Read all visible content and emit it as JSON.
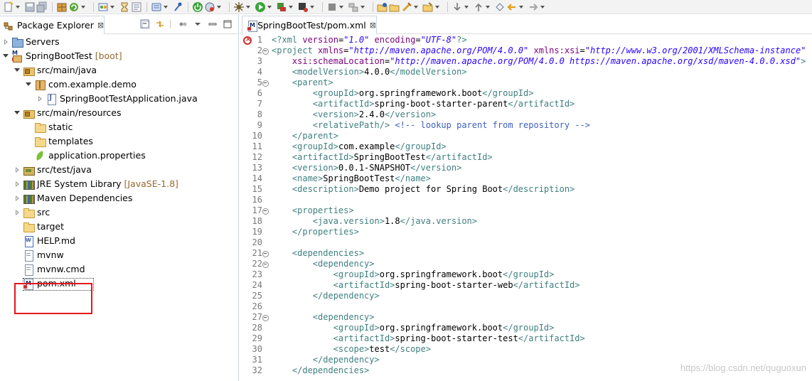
{
  "toolbar": {
    "icons": [
      "new-icon",
      "save-icon",
      "save-all-icon",
      "build-icon",
      "refresh-icon",
      "open-type-icon",
      "task-icon",
      "browse-icon",
      "toggle-breakpoint-icon",
      "skip-breakpoints-icon",
      "spring-icon",
      "debug-icon",
      "run-icon",
      "external-tools-icon",
      "coverage-icon",
      "server-icon",
      "build-project-icon",
      "new-folder-icon",
      "open-folder-icon",
      "search-icon",
      "open-file-icon",
      "annotation-next-icon",
      "annotation-prev-icon",
      "last-edit-icon",
      "back-icon",
      "forward-icon"
    ]
  },
  "explorer": {
    "tab_title": "Package Explorer",
    "close_symbol": "⊠",
    "tree": [
      {
        "label": "Servers",
        "decoration": "",
        "level": 0,
        "expand": "closed",
        "icon": "servers"
      },
      {
        "label": "SpringBootTest",
        "decoration": " [boot]",
        "level": 0,
        "expand": "open",
        "icon": "project"
      },
      {
        "label": "src/main/java",
        "decoration": "",
        "level": 1,
        "expand": "open",
        "icon": "pkgfolder"
      },
      {
        "label": "com.example.demo",
        "decoration": "",
        "level": 2,
        "expand": "open",
        "icon": "package"
      },
      {
        "label": "SpringBootTestApplication.java",
        "decoration": "",
        "level": 3,
        "expand": "closed",
        "icon": "java"
      },
      {
        "label": "src/main/resources",
        "decoration": "",
        "level": 1,
        "expand": "open",
        "icon": "pkgfolder"
      },
      {
        "label": "static",
        "decoration": "",
        "level": 2,
        "expand": "none",
        "icon": "folder"
      },
      {
        "label": "templates",
        "decoration": "",
        "level": 2,
        "expand": "none",
        "icon": "folder"
      },
      {
        "label": "application.properties",
        "decoration": "",
        "level": 2,
        "expand": "none",
        "icon": "leaf"
      },
      {
        "label": "src/test/java",
        "decoration": "",
        "level": 1,
        "expand": "closed",
        "icon": "srcfolder"
      },
      {
        "label": "JRE System Library",
        "decoration": " [JavaSE-1.8]",
        "level": 1,
        "expand": "closed",
        "icon": "lib"
      },
      {
        "label": "Maven Dependencies",
        "decoration": "",
        "level": 1,
        "expand": "closed",
        "icon": "lib"
      },
      {
        "label": "src",
        "decoration": "",
        "level": 1,
        "expand": "closed",
        "icon": "folder"
      },
      {
        "label": "target",
        "decoration": "",
        "level": 1,
        "expand": "none",
        "icon": "folder"
      },
      {
        "label": "HELP.md",
        "decoration": "",
        "level": 1,
        "expand": "none",
        "icon": "worddoc"
      },
      {
        "label": "mvnw",
        "decoration": "",
        "level": 1,
        "expand": "none",
        "icon": "doc"
      },
      {
        "label": "mvnw.cmd",
        "decoration": "",
        "level": 1,
        "expand": "none",
        "icon": "doc"
      },
      {
        "label": "pom.xml",
        "decoration": "",
        "level": 1,
        "expand": "none",
        "icon": "xml",
        "selected": true
      }
    ]
  },
  "editor": {
    "tab_title": "SpringBootTest/pom.xml",
    "lines": [
      {
        "n": "1",
        "fold": false,
        "indent": "",
        "parts": [
          [
            "pi",
            "<?"
          ],
          [
            "tg",
            "xml "
          ],
          [
            "at",
            "version"
          ],
          [
            "tx",
            "="
          ],
          [
            "av",
            "\"1.0\""
          ],
          [
            "tx",
            " "
          ],
          [
            "at",
            "encoding"
          ],
          [
            "tx",
            "="
          ],
          [
            "av",
            "\"UTF-8\""
          ],
          [
            "pi",
            "?>"
          ]
        ]
      },
      {
        "n": "2",
        "fold": true,
        "indent": "",
        "parts": [
          [
            "tg",
            "<project "
          ],
          [
            "at",
            "xmlns"
          ],
          [
            "tx",
            "="
          ],
          [
            "av",
            "\"http://maven.apache.org/POM/4.0.0\""
          ],
          [
            "tx",
            " "
          ],
          [
            "at",
            "xmlns:xsi"
          ],
          [
            "tx",
            "="
          ],
          [
            "av",
            "\"http://www.w3.org/2001/XMLSchema-instance\""
          ]
        ]
      },
      {
        "n": "3",
        "fold": false,
        "indent": "    ",
        "parts": [
          [
            "at",
            "xsi:schemaLocation"
          ],
          [
            "tx",
            "="
          ],
          [
            "av",
            "\"http://maven.apache.org/POM/4.0.0 https://maven.apache.org/xsd/maven-4.0.0.xsd\""
          ],
          [
            "tg",
            ">"
          ]
        ]
      },
      {
        "n": "4",
        "fold": false,
        "indent": "    ",
        "parts": [
          [
            "tg",
            "<modelVersion>"
          ],
          [
            "tx",
            "4.0.0"
          ],
          [
            "tg",
            "</modelVersion>"
          ]
        ]
      },
      {
        "n": "5",
        "fold": true,
        "indent": "    ",
        "parts": [
          [
            "tg",
            "<parent>"
          ]
        ]
      },
      {
        "n": "6",
        "fold": false,
        "indent": "        ",
        "parts": [
          [
            "tg",
            "<groupId>"
          ],
          [
            "tx",
            "org.springframework.boot"
          ],
          [
            "tg",
            "</groupId>"
          ]
        ]
      },
      {
        "n": "7",
        "fold": false,
        "indent": "        ",
        "parts": [
          [
            "tg",
            "<artifactId>"
          ],
          [
            "tx",
            "spring-boot-starter-parent"
          ],
          [
            "tg",
            "</artifactId>"
          ]
        ]
      },
      {
        "n": "8",
        "fold": false,
        "indent": "        ",
        "parts": [
          [
            "tg",
            "<version>"
          ],
          [
            "tx",
            "2.4.0"
          ],
          [
            "tg",
            "</version>"
          ]
        ]
      },
      {
        "n": "9",
        "fold": false,
        "indent": "        ",
        "parts": [
          [
            "tg",
            "<relativePath/>"
          ],
          [
            "tx",
            " "
          ],
          [
            "cm",
            "<!-- lookup parent from repository -->"
          ]
        ]
      },
      {
        "n": "10",
        "fold": false,
        "indent": "    ",
        "parts": [
          [
            "tg",
            "</parent>"
          ]
        ]
      },
      {
        "n": "11",
        "fold": false,
        "indent": "    ",
        "parts": [
          [
            "tg",
            "<groupId>"
          ],
          [
            "tx",
            "com.example"
          ],
          [
            "tg",
            "</groupId>"
          ]
        ]
      },
      {
        "n": "12",
        "fold": false,
        "indent": "    ",
        "parts": [
          [
            "tg",
            "<artifactId>"
          ],
          [
            "tx",
            "SpringBootTest"
          ],
          [
            "tg",
            "</artifactId>"
          ]
        ]
      },
      {
        "n": "13",
        "fold": false,
        "indent": "    ",
        "parts": [
          [
            "tg",
            "<version>"
          ],
          [
            "tx",
            "0.0.1-SNAPSHOT"
          ],
          [
            "tg",
            "</version>"
          ]
        ]
      },
      {
        "n": "14",
        "fold": false,
        "indent": "    ",
        "parts": [
          [
            "tg",
            "<name>"
          ],
          [
            "tx",
            "SpringBootTest"
          ],
          [
            "tg",
            "</name>"
          ]
        ]
      },
      {
        "n": "15",
        "fold": false,
        "indent": "    ",
        "parts": [
          [
            "tg",
            "<description>"
          ],
          [
            "tx",
            "Demo project for Spring Boot"
          ],
          [
            "tg",
            "</description>"
          ]
        ]
      },
      {
        "n": "16",
        "fold": false,
        "indent": "",
        "parts": []
      },
      {
        "n": "17",
        "fold": true,
        "indent": "    ",
        "parts": [
          [
            "tg",
            "<properties>"
          ]
        ]
      },
      {
        "n": "18",
        "fold": false,
        "indent": "        ",
        "parts": [
          [
            "tg",
            "<java.version>"
          ],
          [
            "tx",
            "1.8"
          ],
          [
            "tg",
            "</java.version>"
          ]
        ]
      },
      {
        "n": "19",
        "fold": false,
        "indent": "    ",
        "parts": [
          [
            "tg",
            "</properties>"
          ]
        ]
      },
      {
        "n": "20",
        "fold": false,
        "indent": "",
        "parts": []
      },
      {
        "n": "21",
        "fold": true,
        "indent": "    ",
        "parts": [
          [
            "tg",
            "<dependencies>"
          ]
        ]
      },
      {
        "n": "22",
        "fold": true,
        "indent": "        ",
        "parts": [
          [
            "tg",
            "<dependency>"
          ]
        ]
      },
      {
        "n": "23",
        "fold": false,
        "indent": "            ",
        "parts": [
          [
            "tg",
            "<groupId>"
          ],
          [
            "tx",
            "org.springframework.boot"
          ],
          [
            "tg",
            "</groupId>"
          ]
        ]
      },
      {
        "n": "24",
        "fold": false,
        "indent": "            ",
        "parts": [
          [
            "tg",
            "<artifactId>"
          ],
          [
            "tx",
            "spring-boot-starter-web"
          ],
          [
            "tg",
            "</artifactId>"
          ]
        ]
      },
      {
        "n": "25",
        "fold": false,
        "indent": "        ",
        "parts": [
          [
            "tg",
            "</dependency>"
          ]
        ]
      },
      {
        "n": "26",
        "fold": false,
        "indent": "",
        "parts": []
      },
      {
        "n": "27",
        "fold": true,
        "indent": "        ",
        "parts": [
          [
            "tg",
            "<dependency>"
          ]
        ]
      },
      {
        "n": "28",
        "fold": false,
        "indent": "            ",
        "parts": [
          [
            "tg",
            "<groupId>"
          ],
          [
            "tx",
            "org.springframework.boot"
          ],
          [
            "tg",
            "</groupId>"
          ]
        ]
      },
      {
        "n": "29",
        "fold": false,
        "indent": "            ",
        "parts": [
          [
            "tg",
            "<artifactId>"
          ],
          [
            "tx",
            "spring-boot-starter-test"
          ],
          [
            "tg",
            "</artifactId>"
          ]
        ]
      },
      {
        "n": "30",
        "fold": false,
        "indent": "            ",
        "parts": [
          [
            "tg",
            "<scope>"
          ],
          [
            "tx",
            "test"
          ],
          [
            "tg",
            "</scope>"
          ]
        ]
      },
      {
        "n": "31",
        "fold": false,
        "indent": "        ",
        "parts": [
          [
            "tg",
            "</dependency>"
          ]
        ]
      },
      {
        "n": "32",
        "fold": false,
        "indent": "    ",
        "parts": [
          [
            "tg",
            "</dependencies>"
          ]
        ]
      }
    ]
  },
  "watermark": "https://blog.csdn.net/quguoxun",
  "colors": {
    "highlight": "#e4161c",
    "tag": "#3f7f7f",
    "attribute": "#7f007f",
    "value": "#2a00ff",
    "comment": "#3f5fbf",
    "decoration": "#946a30"
  }
}
